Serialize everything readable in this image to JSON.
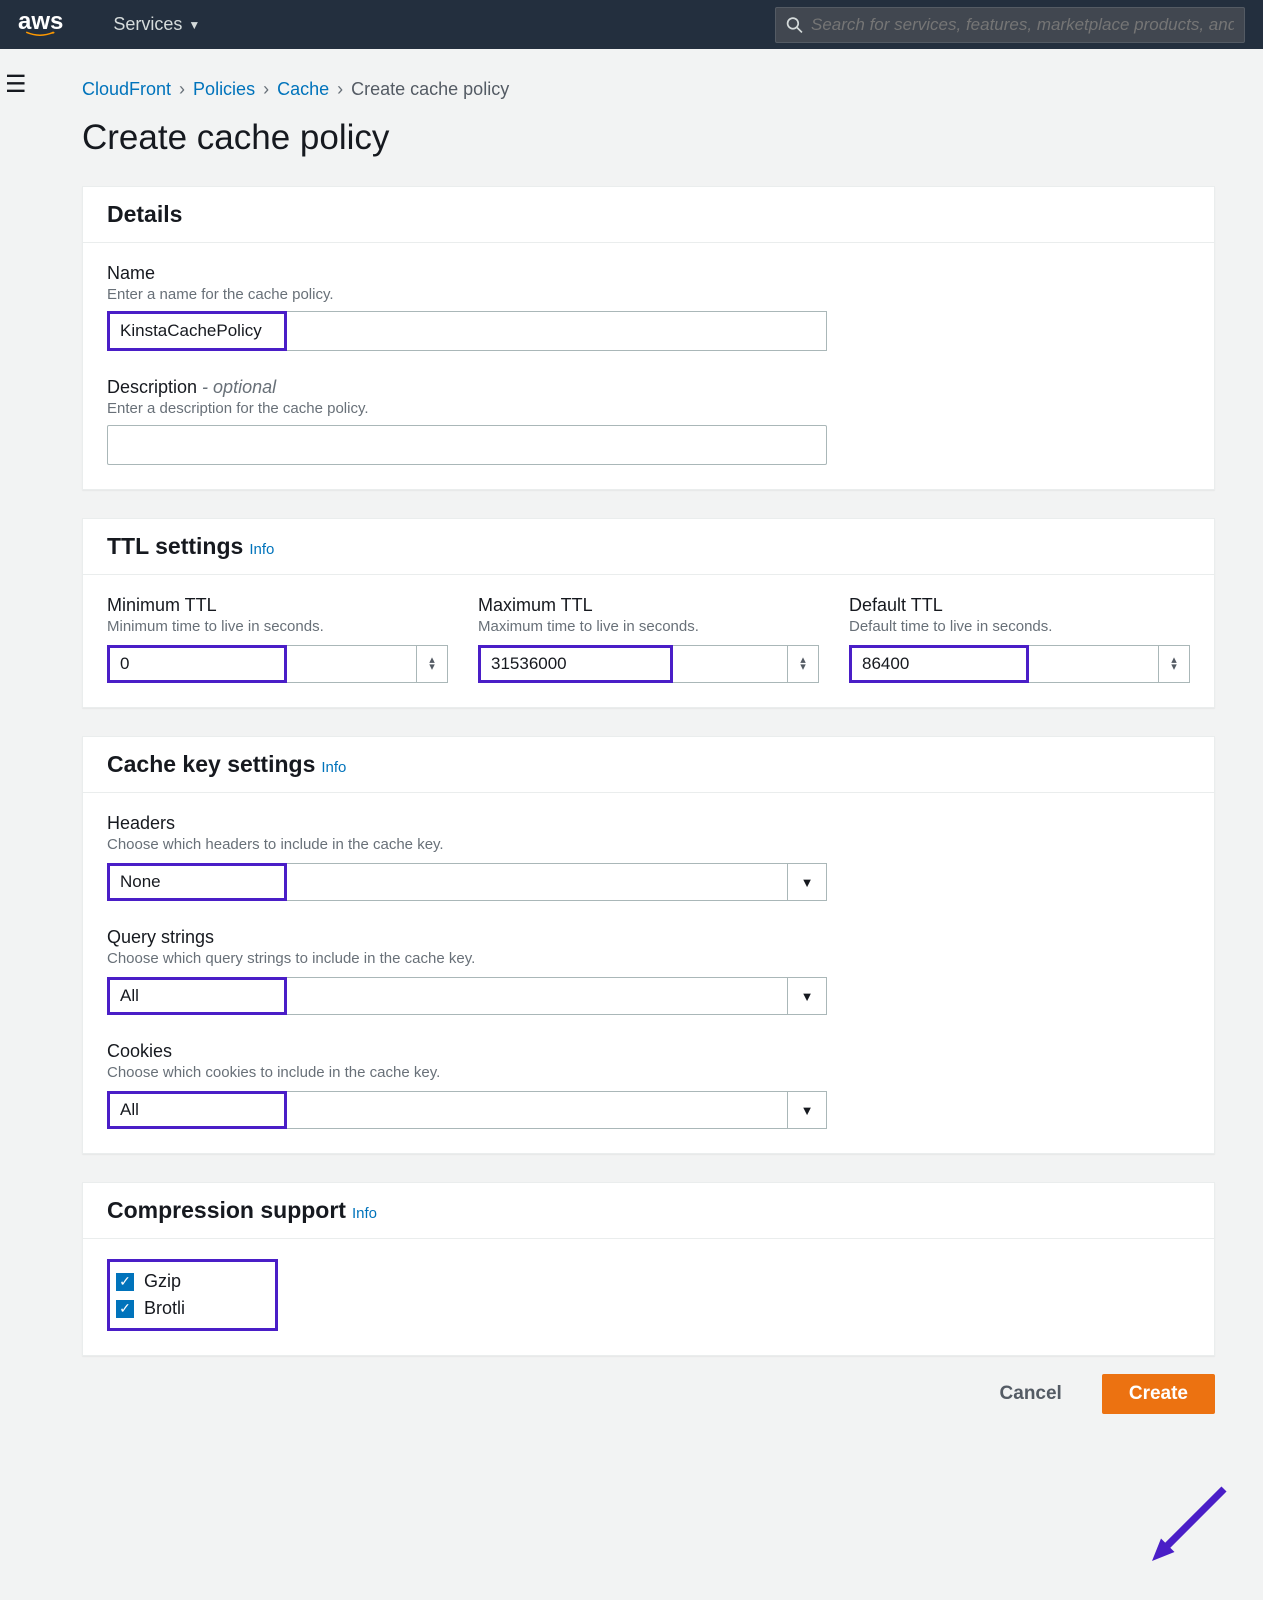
{
  "header": {
    "logo_text": "aws",
    "services_label": "Services",
    "search_placeholder": "Search for services, features, marketplace products, and"
  },
  "breadcrumb": {
    "items": [
      "CloudFront",
      "Policies",
      "Cache"
    ],
    "current": "Create cache policy"
  },
  "page_title": "Create cache policy",
  "details": {
    "title": "Details",
    "name_label": "Name",
    "name_help": "Enter a name for the cache policy.",
    "name_value": "KinstaCachePolicy",
    "desc_label": "Description",
    "desc_optional": " - optional",
    "desc_help": "Enter a description for the cache policy.",
    "desc_value": ""
  },
  "ttl": {
    "title": "TTL settings",
    "info": "Info",
    "min_label": "Minimum TTL",
    "min_help": "Minimum time to live in seconds.",
    "min_value": "0",
    "max_label": "Maximum TTL",
    "max_help": "Maximum time to live in seconds.",
    "max_value": "31536000",
    "def_label": "Default TTL",
    "def_help": "Default time to live in seconds.",
    "def_value": "86400"
  },
  "cachekey": {
    "title": "Cache key settings",
    "info": "Info",
    "headers_label": "Headers",
    "headers_help": "Choose which headers to include in the cache key.",
    "headers_value": "None",
    "qs_label": "Query strings",
    "qs_help": "Choose which query strings to include in the cache key.",
    "qs_value": "All",
    "cookies_label": "Cookies",
    "cookies_help": "Choose which cookies to include in the cache key.",
    "cookies_value": "All"
  },
  "compression": {
    "title": "Compression support",
    "info": "Info",
    "gzip_label": "Gzip",
    "brotli_label": "Brotli"
  },
  "actions": {
    "cancel": "Cancel",
    "create": "Create"
  }
}
